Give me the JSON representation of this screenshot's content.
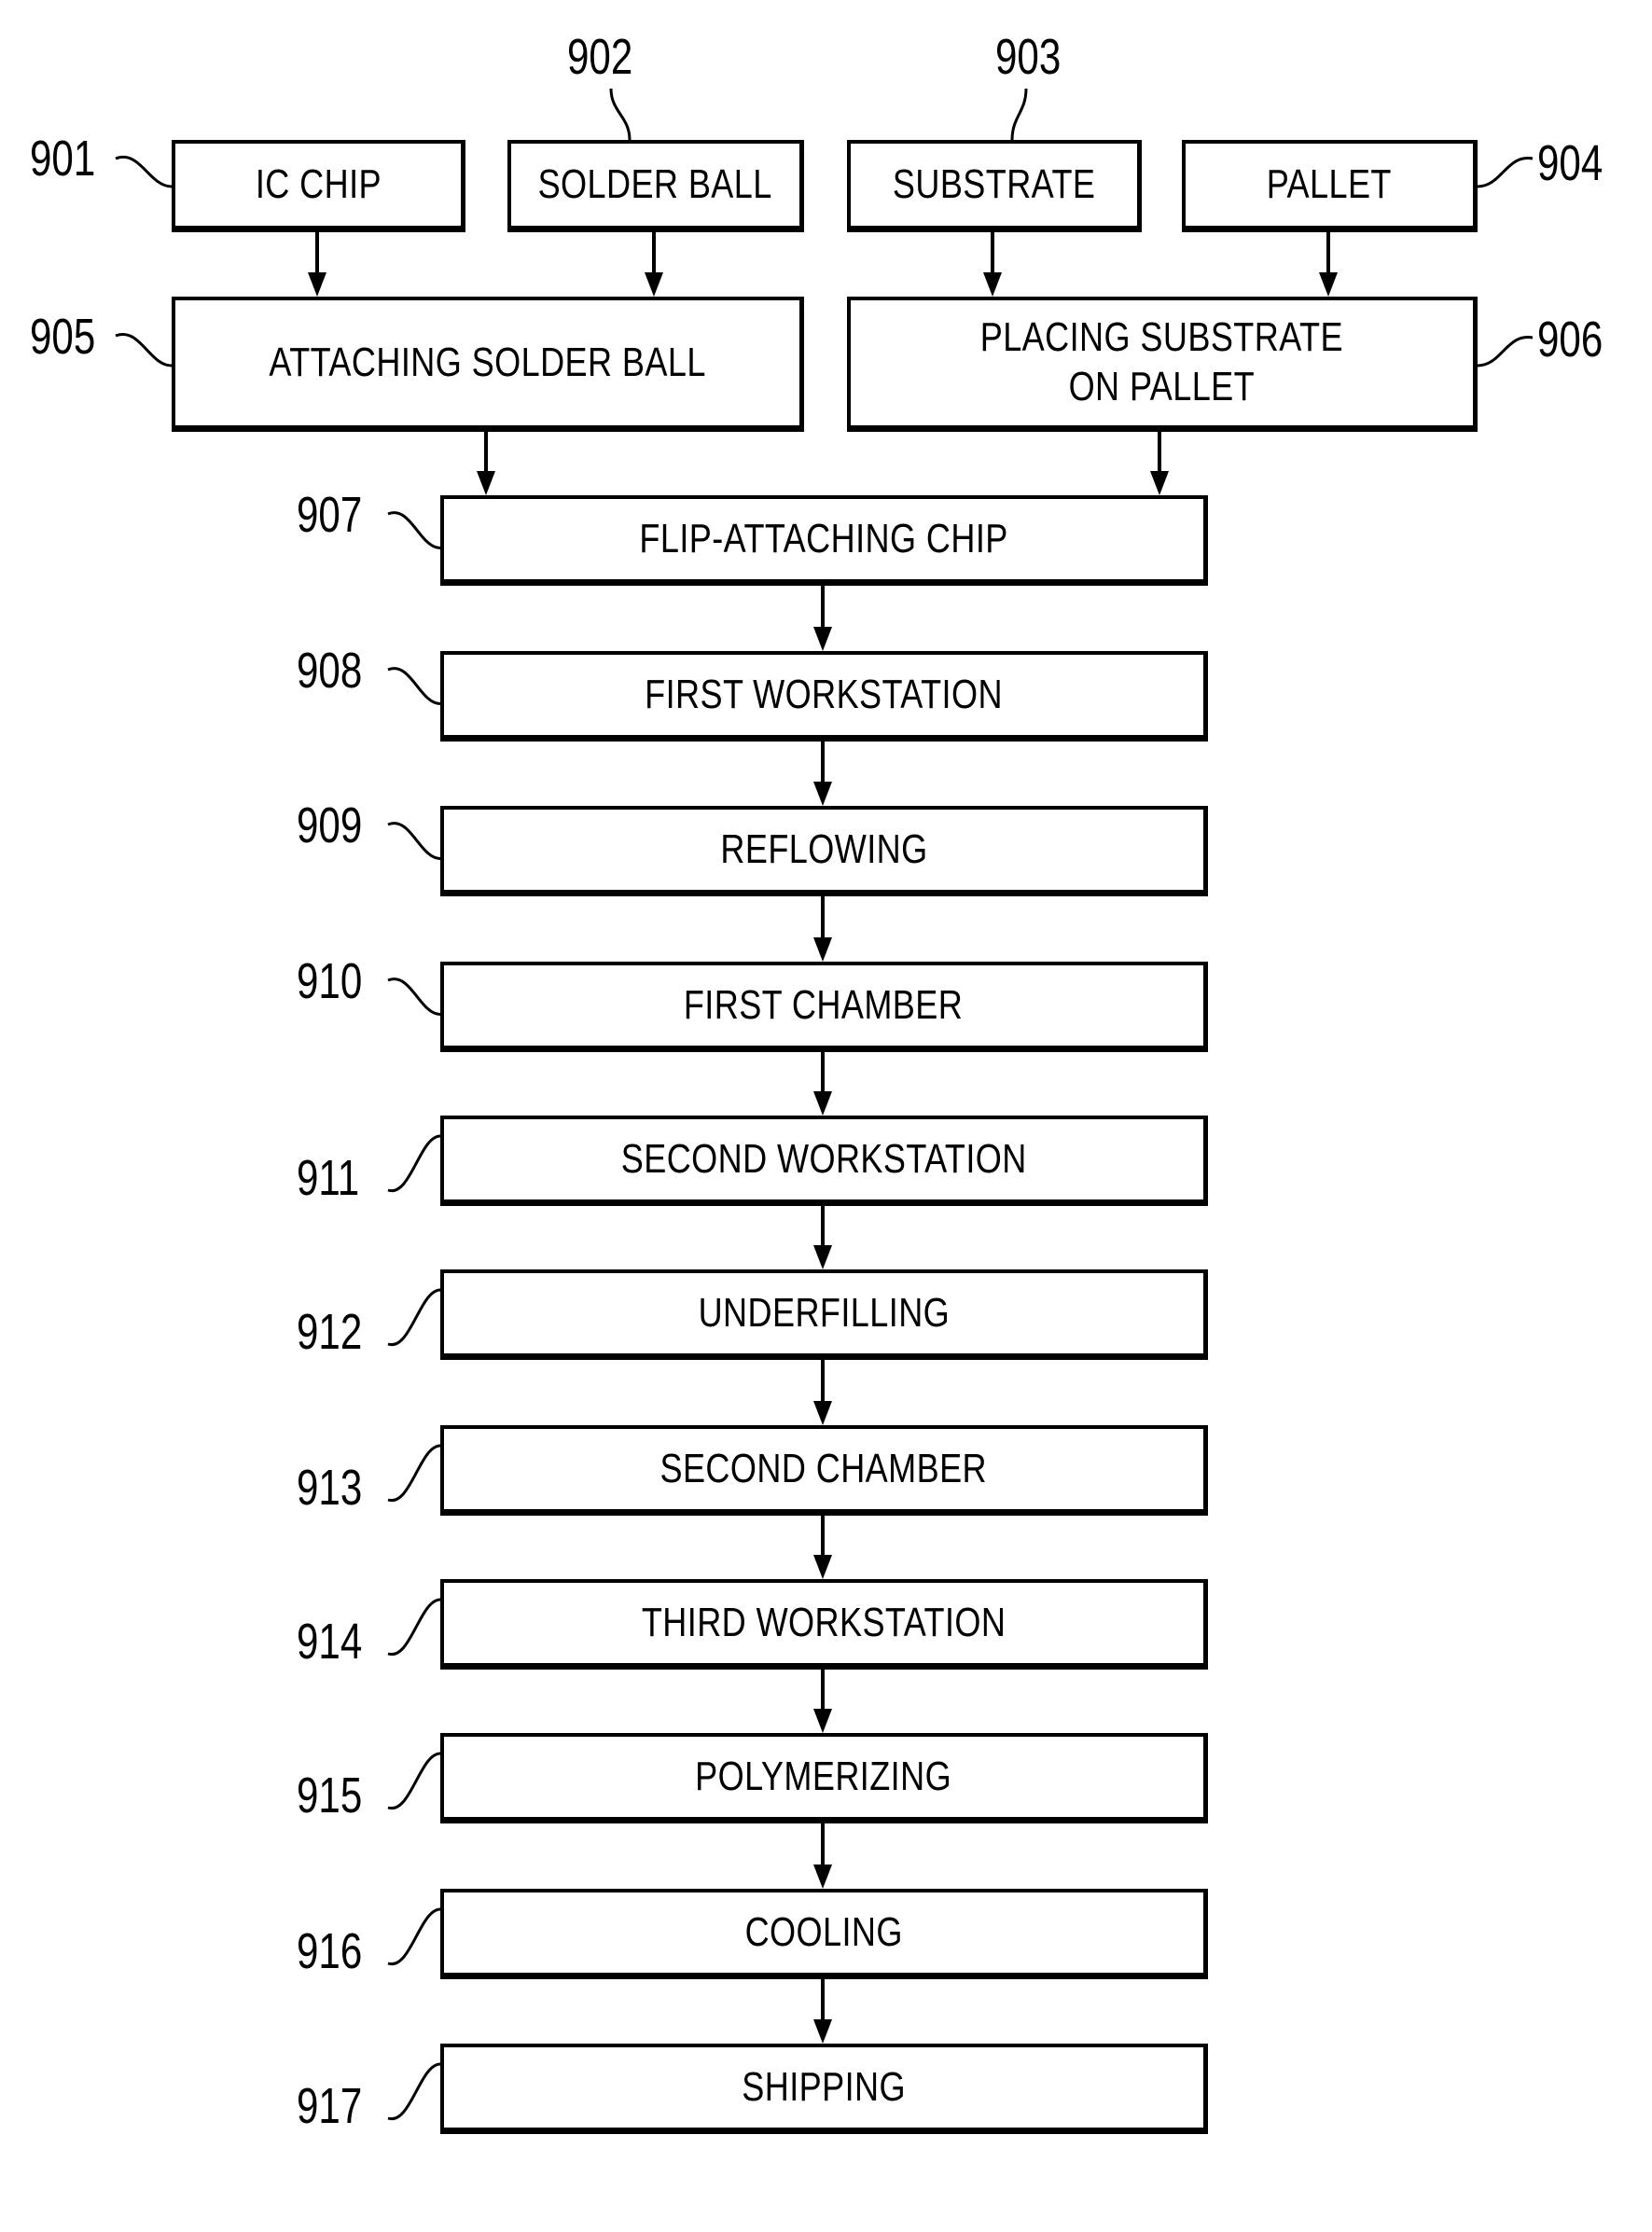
{
  "figure": {
    "type": "process-flowchart",
    "inputs": [
      {
        "ref": "901",
        "label": "IC CHIP"
      },
      {
        "ref": "902",
        "label": "SOLDER BALL"
      },
      {
        "ref": "903",
        "label": "SUBSTRATE"
      },
      {
        "ref": "904",
        "label": "PALLET"
      }
    ],
    "prep_steps": [
      {
        "ref": "905",
        "label": "ATTACHING SOLDER BALL",
        "from": [
          "901",
          "902"
        ]
      },
      {
        "ref": "906",
        "label": "PLACING SUBSTRATE\nON PALLET",
        "from": [
          "903",
          "904"
        ]
      }
    ],
    "chain": [
      {
        "ref": "907",
        "label": "FLIP-ATTACHING CHIP"
      },
      {
        "ref": "908",
        "label": "FIRST WORKSTATION"
      },
      {
        "ref": "909",
        "label": "REFLOWING"
      },
      {
        "ref": "910",
        "label": "FIRST CHAMBER"
      },
      {
        "ref": "911",
        "label": "SECOND WORKSTATION"
      },
      {
        "ref": "912",
        "label": "UNDERFILLING"
      },
      {
        "ref": "913",
        "label": "SECOND CHAMBER"
      },
      {
        "ref": "914",
        "label": "THIRD WORKSTATION"
      },
      {
        "ref": "915",
        "label": "POLYMERIZING"
      },
      {
        "ref": "916",
        "label": "COOLING"
      },
      {
        "ref": "917",
        "label": "SHIPPING"
      }
    ]
  }
}
